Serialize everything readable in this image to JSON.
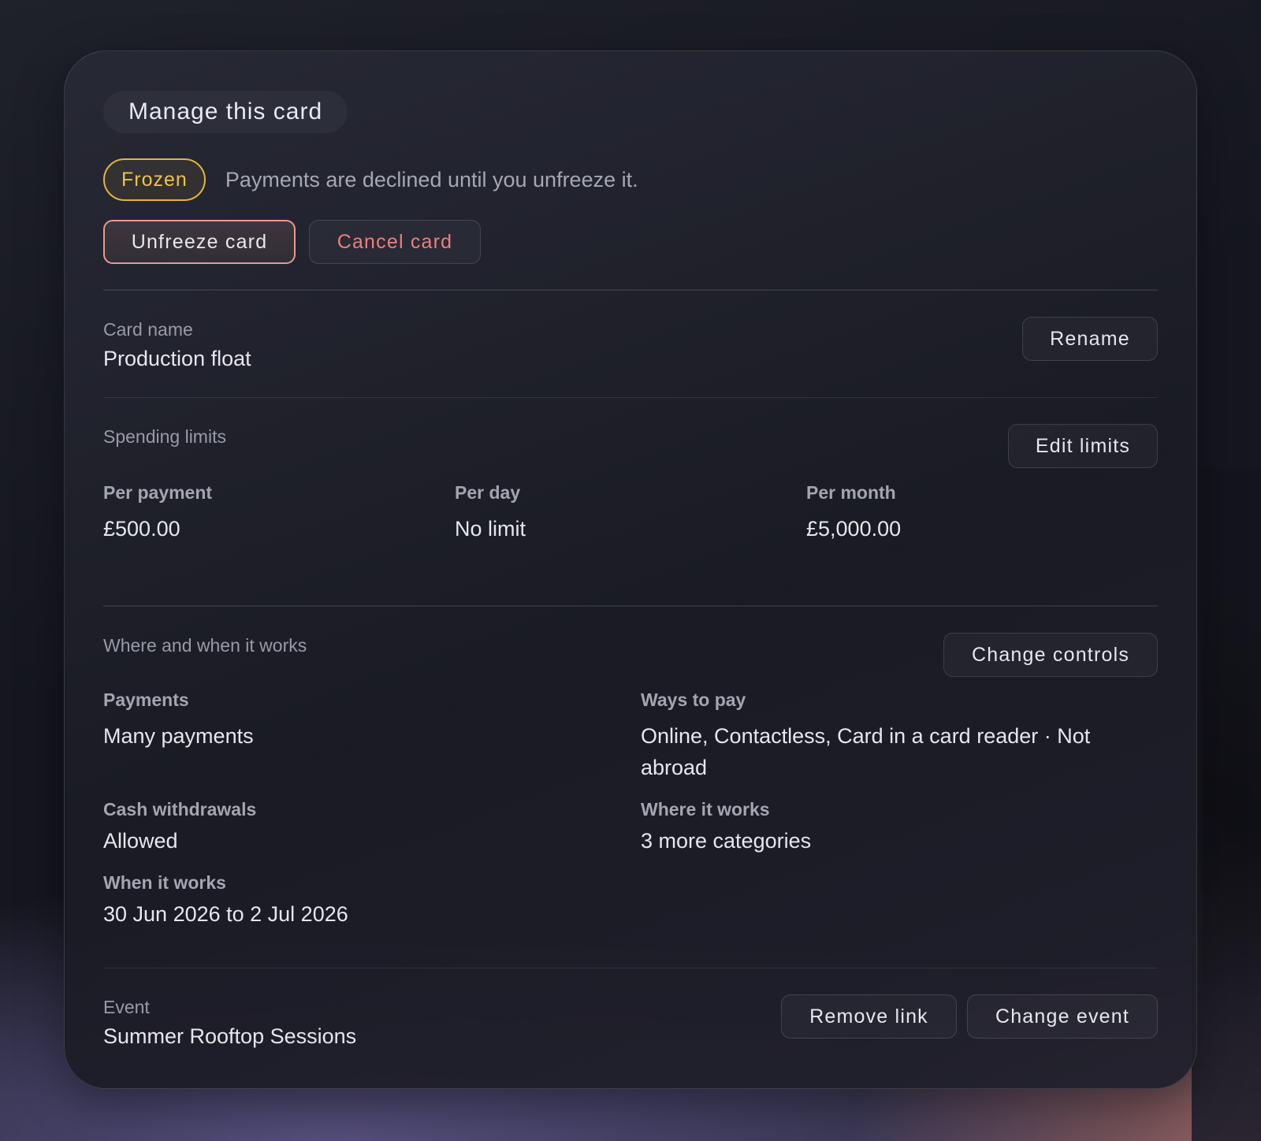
{
  "card": {
    "title": "Manage this card",
    "status_badge": "Frozen",
    "status_text": "Payments are declined until you unfreeze it.",
    "unfreeze_label": "Unfreeze card",
    "cancel_label": "Cancel card"
  },
  "card_name": {
    "label": "Card name",
    "value": "Production float",
    "button": "Rename"
  },
  "limits": {
    "label": "Spending limits",
    "button": "Edit limits",
    "items": [
      {
        "label": "Per payment",
        "value": "£500.00"
      },
      {
        "label": "Per day",
        "value": "No limit"
      },
      {
        "label": "Per month",
        "value": "£5,000.00"
      }
    ]
  },
  "controls": {
    "label": "Where and when it works",
    "button": "Change controls",
    "items": [
      {
        "label": "Payments",
        "value": "Many payments"
      },
      {
        "label": "Ways to pay",
        "value": "Online, Contactless, Card in a card reader · Not abroad"
      },
      {
        "label": "Cash withdrawals",
        "value": "Allowed"
      },
      {
        "label": "Where it works",
        "value": "3 more categories"
      },
      {
        "label": "When it works",
        "value": "30 Jun 2026 to 2 Jul 2026"
      }
    ]
  },
  "event": {
    "label": "Event",
    "value": "Summer Rooftop Sessions",
    "remove_label": "Remove link",
    "change_label": "Change event"
  },
  "colors": {
    "frozen_accent": "#e2b43c",
    "danger_text": "#f07e7a",
    "unfreeze_border": "#e79b8e"
  }
}
